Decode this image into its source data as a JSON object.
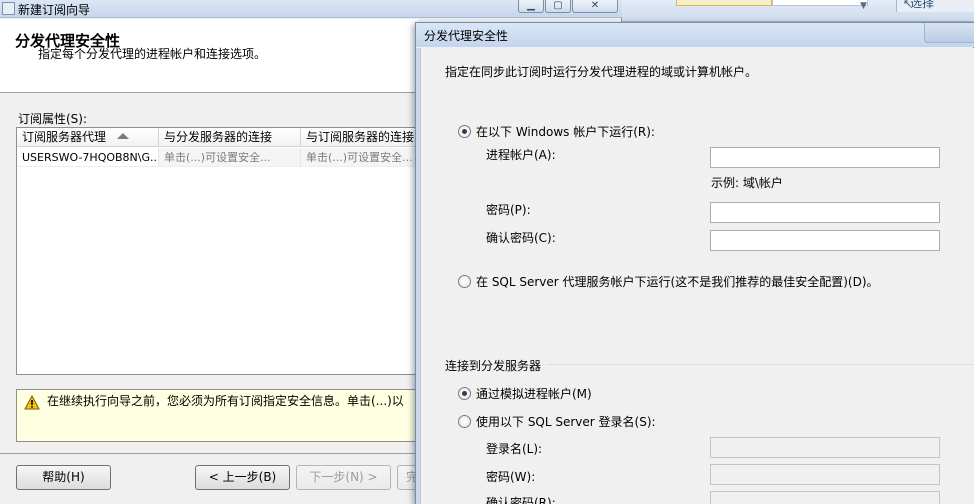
{
  "wizard": {
    "title": "新建订阅向导",
    "window_buttons": {
      "minimize": "▁",
      "maximize": "▢",
      "close": "✕"
    },
    "heading": "分发代理安全性",
    "subheading": "指定每个分发代理的进程帐户和连接选项。",
    "props_label": "订阅属性(S):",
    "grid": {
      "columns": [
        "订阅服务器代理",
        "与分发服务器的连接",
        "与订阅服务器的连接"
      ],
      "rows": [
        [
          "USERSWO-7HQOB8N\\G...",
          "单击(...)可设置安全...",
          "单击(...)可设置安全..."
        ]
      ]
    },
    "warning": "在继续执行向导之前，您必须为所有订阅指定安全信息。单击(...)以",
    "buttons": {
      "help": "帮助(H)",
      "back": "< 上一步(B)",
      "next": "下一步(N) >",
      "finish": "完"
    }
  },
  "taskbar_strip": {
    "select_label": "选择"
  },
  "dialog": {
    "title": "分发代理安全性",
    "description": "指定在同步此订阅时运行分发代理进程的域或计算机帐户。",
    "run_as_windows_label": "在以下 Windows 帐户下运行(R):",
    "process_account_label": "进程帐户(A):",
    "process_account_value": "",
    "example_text": "示例: 域\\帐户",
    "password_label": "密码(P):",
    "password_value": "",
    "confirm_password_label": "确认密码(C):",
    "confirm_password_value": "",
    "run_as_agent_label": "在 SQL Server 代理服务帐户下运行(这不是我们推荐的最佳安全配置)(D)。",
    "connect_group_label": "连接到分发服务器",
    "impersonate_label": "通过模拟进程帐户(M)",
    "sql_login_label": "使用以下 SQL Server 登录名(S):",
    "login_name_label": "登录名(L):",
    "login_password_label": "密码(W):",
    "login_confirm_label": "确认密码(R):"
  }
}
